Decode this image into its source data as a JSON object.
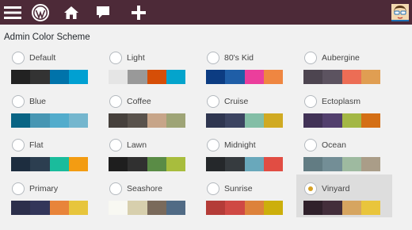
{
  "topbar": {
    "icons": [
      "menu-icon",
      "wordpress-logo-icon",
      "home-icon",
      "comment-icon",
      "plus-icon",
      "avatar"
    ]
  },
  "section": {
    "title": "Admin Color Scheme"
  },
  "schemes": [
    {
      "name": "Default",
      "colors": [
        "#222",
        "#333",
        "#0073aa",
        "#00a0d2"
      ],
      "selected": false
    },
    {
      "name": "Light",
      "colors": [
        "#e5e5e5",
        "#999",
        "#d64e07",
        "#04a4cc"
      ],
      "selected": false
    },
    {
      "name": "80's Kid",
      "colors": [
        "#0c3c82",
        "#1f5ea7",
        "#eb3e9c",
        "#ef8641"
      ],
      "selected": false
    },
    {
      "name": "Aubergine",
      "colors": [
        "#4d4550",
        "#5c5360",
        "#ec6d55",
        "#e09e52"
      ],
      "selected": false
    },
    {
      "name": "Blue",
      "colors": [
        "#096484",
        "#4796b3",
        "#52accc",
        "#74b6ce"
      ],
      "selected": false
    },
    {
      "name": "Coffee",
      "colors": [
        "#46403c",
        "#59524c",
        "#c7a589",
        "#9ea476"
      ],
      "selected": false
    },
    {
      "name": "Cruise",
      "colors": [
        "#2f3650",
        "#3c4461",
        "#83bea6",
        "#d0aa22"
      ],
      "selected": false
    },
    {
      "name": "Ectoplasm",
      "colors": [
        "#413256",
        "#523f6d",
        "#a3b745",
        "#d46f15"
      ],
      "selected": false
    },
    {
      "name": "Flat",
      "colors": [
        "#1d2d3f",
        "#2c3e50",
        "#1abc9c",
        "#f39c12"
      ],
      "selected": false
    },
    {
      "name": "Lawn",
      "colors": [
        "#1e1e1e",
        "#303030",
        "#5a8c46",
        "#a8bd3d"
      ],
      "selected": false
    },
    {
      "name": "Midnight",
      "colors": [
        "#25282b",
        "#363b3f",
        "#69a8bb",
        "#e14d43"
      ],
      "selected": false
    },
    {
      "name": "Ocean",
      "colors": [
        "#627c83",
        "#738e96",
        "#9ebaa0",
        "#aa9d88"
      ],
      "selected": false
    },
    {
      "name": "Primary",
      "colors": [
        "#2c2f4b",
        "#33365a",
        "#e8843a",
        "#e7c53c"
      ],
      "selected": false
    },
    {
      "name": "Seashore",
      "colors": [
        "#f8f8f2",
        "#d7cfad",
        "#7a6a5b",
        "#516b85"
      ],
      "selected": false
    },
    {
      "name": "Sunrise",
      "colors": [
        "#b43c38",
        "#cf4944",
        "#dd823b",
        "#ccaf0b"
      ],
      "selected": false
    },
    {
      "name": "Vinyard",
      "colors": [
        "#30212b",
        "#432e3b",
        "#d6a560",
        "#e9c53c"
      ],
      "selected": true
    }
  ]
}
